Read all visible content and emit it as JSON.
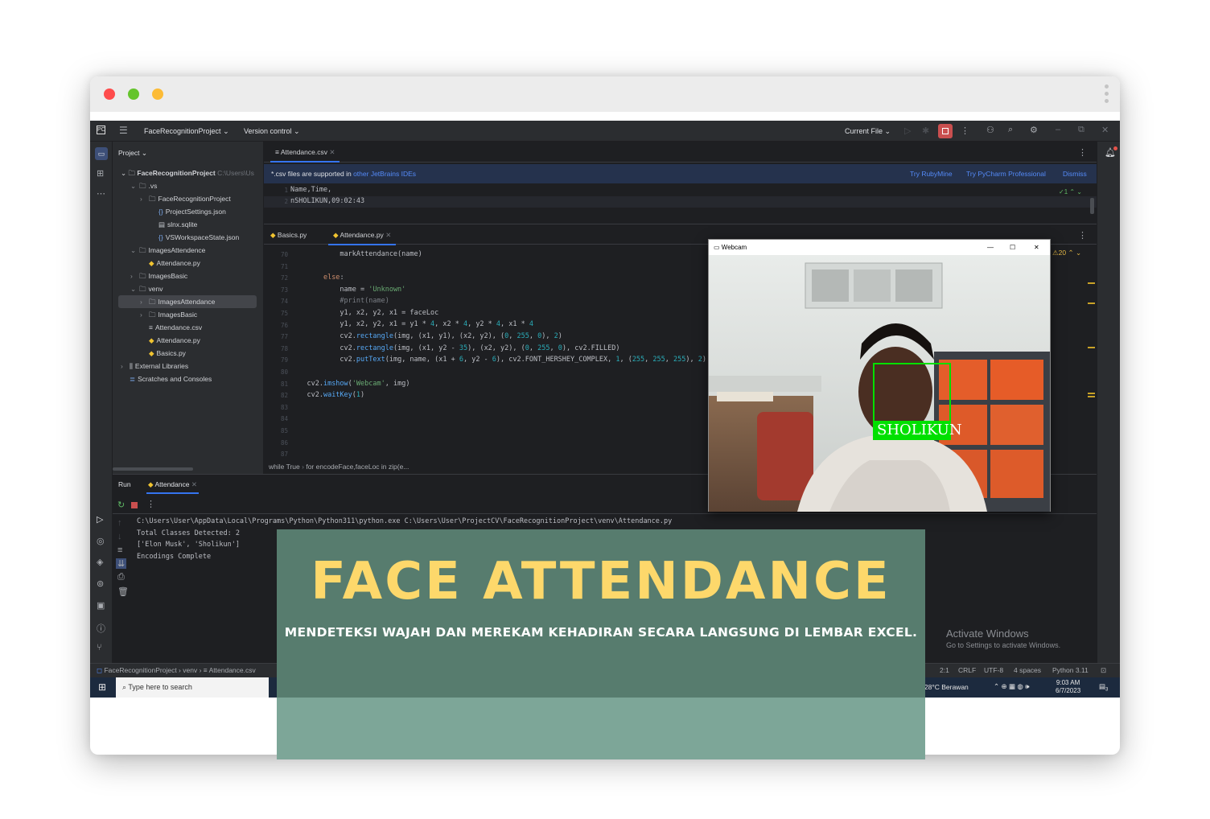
{
  "ide": {
    "project_name": "FaceRecognitionProject",
    "vcs_label": "Version control",
    "run_config": "Current File"
  },
  "project_panel": {
    "title": "Project",
    "root_label": "FaceRecognitionProject",
    "root_path": "C:\\Users\\Us",
    "items": [
      {
        "label": ".vs",
        "icon": "folder-icon"
      },
      {
        "label": "FaceRecognitionProject",
        "icon": "folder-icon"
      },
      {
        "label": "ProjectSettings.json",
        "icon": "json-icon"
      },
      {
        "label": "slnx.sqlite",
        "icon": "file-icon"
      },
      {
        "label": "VSWorkspaceState.json",
        "icon": "json-icon"
      },
      {
        "label": "ImagesAttendence",
        "icon": "folder-icon"
      },
      {
        "label": "Attendance.py",
        "icon": "python-icon"
      },
      {
        "label": "ImagesBasic",
        "icon": "folder-icon"
      },
      {
        "label": "venv",
        "icon": "folder-icon"
      },
      {
        "label": "ImagesAttendance",
        "icon": "folder-icon"
      },
      {
        "label": "ImagesBasic",
        "icon": "folder-icon"
      },
      {
        "label": "Attendance.csv",
        "icon": "csv-icon"
      },
      {
        "label": "Attendance.py",
        "icon": "python-icon"
      },
      {
        "label": "Basics.py",
        "icon": "python-icon"
      },
      {
        "label": "External Libraries",
        "icon": "library-icon"
      },
      {
        "label": "Scratches and Consoles",
        "icon": "scratch-icon"
      }
    ]
  },
  "editor_top": {
    "tab": "Attendance.csv",
    "banner_text": "*.csv files are supported in",
    "banner_link": "other JetBrains IDEs",
    "banner_actions": [
      "Try RubyMine",
      "Try PyCharm Professional",
      "Dismiss"
    ],
    "inspection": "1",
    "lines": [
      {
        "n": "1",
        "text": "Name,Time,"
      },
      {
        "n": "2",
        "text": "nSHOLIKUN,09:02:43"
      }
    ]
  },
  "editor_bottom": {
    "tabs": [
      "Basics.py",
      "Attendance.py"
    ],
    "warnings": "20",
    "line_numbers": [
      "70",
      "71",
      "72",
      "73",
      "74",
      "75",
      "76",
      "77",
      "78",
      "79",
      "80",
      "81",
      "82",
      "83",
      "84",
      "85",
      "86",
      "87"
    ],
    "breadcrumb": [
      "while True",
      "for encodeFace,faceLoc in zip(e..."
    ]
  },
  "run": {
    "label": "Run",
    "tab": "Attendance",
    "output": [
      "C:\\Users\\User\\AppData\\Local\\Programs\\Python\\Python311\\python.exe C:\\Users\\User\\ProjectCV\\FaceRecognitionProject\\venv\\Attendance.py",
      "Total Classes Detected: 2",
      "['Elon Musk', 'Sholikun']",
      "Encodings Complete"
    ]
  },
  "activate": {
    "title": "Activate Windows",
    "subtitle": "Go to Settings to activate Windows."
  },
  "statusbar": {
    "path": [
      "FaceRecognitionProject",
      "venv",
      "Attendance.csv"
    ],
    "right": [
      "2:1",
      "CRLF",
      "UTF-8",
      "4 spaces",
      "Python 3.11"
    ]
  },
  "taskbar": {
    "search_placeholder": "Type here to search",
    "weather": "28°C  Berawan",
    "time": "9:03 AM",
    "date": "6/7/2023",
    "notifications": "3"
  },
  "webcam": {
    "title": "Webcam",
    "face_label": "SHOLIKUN"
  },
  "overlay": {
    "title": "FACE ATTENDANCE",
    "subtitle": "MENDETEKSI WAJAH DAN MEREKAM KEHADIRAN SECARA LANGSUNG DI LEMBAR EXCEL."
  },
  "colors": {
    "overlay_bg": "#577c6e",
    "overlay_title": "#fdd86b",
    "face_box": "#00e000"
  }
}
